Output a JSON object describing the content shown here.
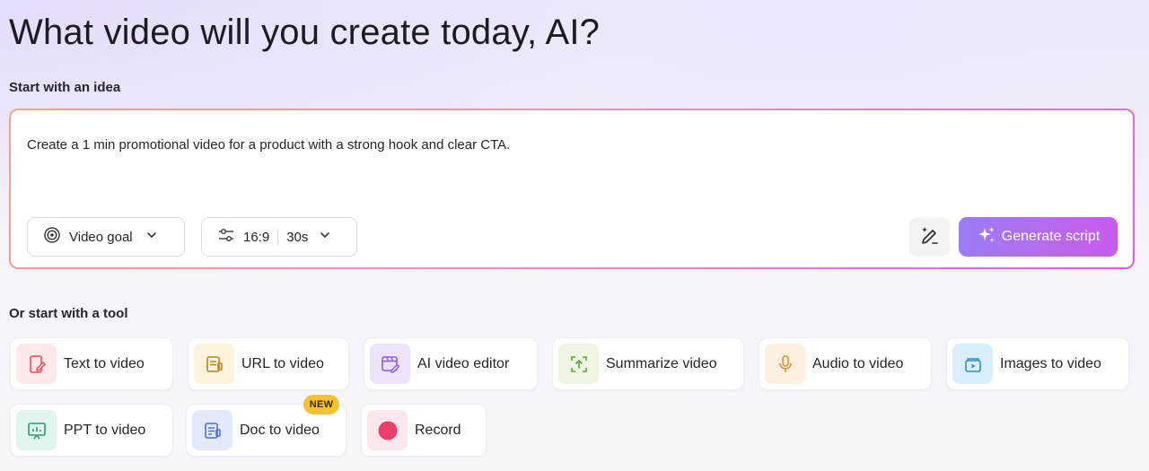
{
  "page": {
    "title": "What video will you create today, AI?",
    "idea_section_label": "Start with an idea",
    "tool_section_label": "Or start with a tool"
  },
  "prompt": {
    "text": "Create a 1 min promotional video for a product with a strong hook and clear CTA."
  },
  "controls": {
    "video_goal_label": "Video goal",
    "aspect_ratio": "16:9",
    "duration": "30s",
    "generate_label": "Generate script"
  },
  "tools": [
    {
      "label": "Text to video",
      "icon": "text-video-icon",
      "color": "#e94f5a"
    },
    {
      "label": "URL to video",
      "icon": "url-document-icon",
      "color": "#b8841a"
    },
    {
      "label": "AI video editor",
      "icon": "ai-editor-icon",
      "color": "#8a5cd8"
    },
    {
      "label": "Summarize video",
      "icon": "summarize-icon",
      "color": "#5ca33a"
    },
    {
      "label": "Audio to video",
      "icon": "microphone-icon",
      "color": "#d9923a"
    },
    {
      "label": "Images to video",
      "icon": "images-icon",
      "color": "#2a8fc6"
    },
    {
      "label": "PPT to video",
      "icon": "presentation-icon",
      "color": "#2b9d6e"
    },
    {
      "label": "Doc to video",
      "icon": "document-icon",
      "color": "#4f6fd0"
    },
    {
      "label": "Record",
      "icon": "record-icon",
      "color": "#ee3f6b"
    }
  ],
  "badges": {
    "new": "NEW"
  },
  "colors": {
    "accent_gradient_start": "#9b7cf5",
    "accent_gradient_end": "#c85bed",
    "new_badge": "#f6c232"
  }
}
